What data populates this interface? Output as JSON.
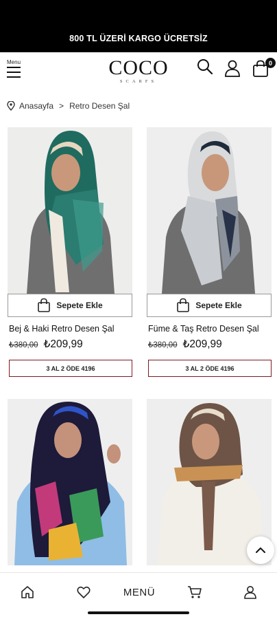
{
  "announcement": {
    "text": "800 TL ÜZERİ KARGO ÜCRETSİZ"
  },
  "header": {
    "menu_label": "Menu",
    "logo_main": "COCO",
    "logo_sub": "SCARFS",
    "cart_count": "0",
    "icons": [
      "search-icon",
      "user-icon",
      "shopping-bag-icon"
    ]
  },
  "breadcrumb": {
    "home": "Anasayfa",
    "separator": ">",
    "current": "Retro Desen Şal"
  },
  "products": [
    {
      "add_label": "Sepete Ekle",
      "name": "Bej & Haki Retro Desen Şal",
      "old_price": "₺380,00",
      "new_price": "₺209,99",
      "promo": "3 AL 2 ÖDE 4196"
    },
    {
      "add_label": "Sepete Ekle",
      "name": "Füme & Taş Retro Desen Şal",
      "old_price": "₺380,00",
      "new_price": "₺209,99",
      "promo": "3 AL 2 ÖDE 4196"
    },
    {
      "add_label": "",
      "name": "",
      "old_price": "",
      "new_price": "",
      "promo": ""
    },
    {
      "add_label": "",
      "name": "",
      "old_price": "",
      "new_price": "",
      "promo": ""
    }
  ],
  "bottom_nav": {
    "menu_label": "MENÜ",
    "icons": [
      "home-icon",
      "heart-icon",
      "menu",
      "cart-icon",
      "account-icon"
    ]
  },
  "colors": {
    "topbar": "#000000",
    "promo_border": "#7a1a24",
    "image_bg": "#eeeeee"
  }
}
